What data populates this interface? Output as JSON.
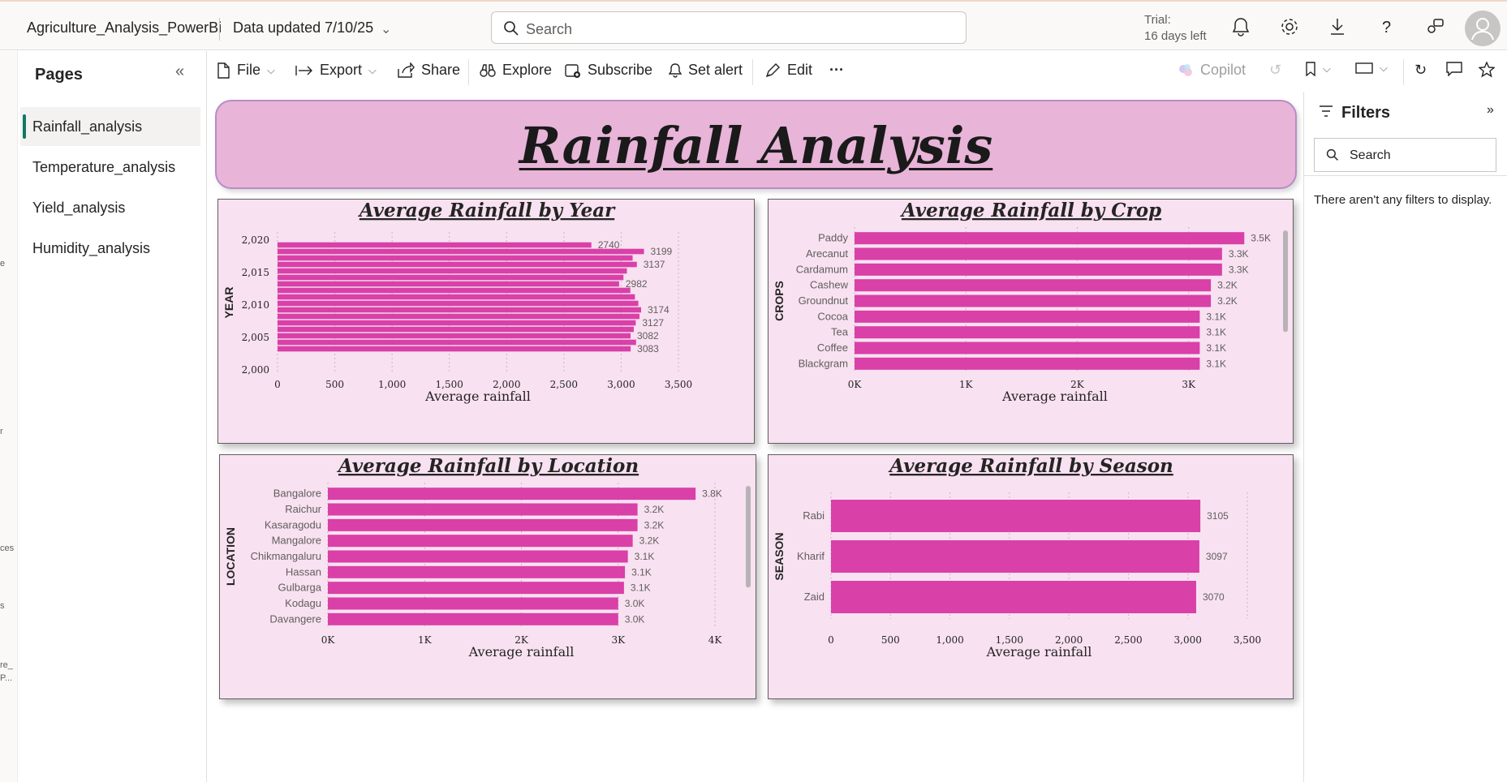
{
  "topbar": {
    "app_name": "Agriculture_Analysis_PowerBi",
    "updated": "Data updated 7/10/25",
    "search_placeholder": "Search",
    "trial_line1": "Trial:",
    "trial_line2": "16 days left"
  },
  "leftrail": {
    "fragments": [
      "e",
      "r",
      "ces",
      "s",
      "re_",
      "P..."
    ]
  },
  "pages": {
    "title": "Pages",
    "items": [
      {
        "label": "Rainfall_analysis",
        "active": true
      },
      {
        "label": "Temperature_analysis",
        "active": false
      },
      {
        "label": "Yield_analysis",
        "active": false
      },
      {
        "label": "Humidity_analysis",
        "active": false
      }
    ]
  },
  "commandbar": {
    "file": "File",
    "export": "Export",
    "share": "Share",
    "explore": "Explore",
    "subscribe": "Subscribe",
    "set_alert": "Set alert",
    "edit": "Edit",
    "more": "···",
    "copilot": "Copilot"
  },
  "filters": {
    "title": "Filters",
    "search_placeholder": "Search",
    "empty_message": "There aren't any filters to display."
  },
  "report": {
    "title": "Rainfall Analysis",
    "bar_color": "#d940a8",
    "panel_bg": "#f8e1f1",
    "banner_bg": "#e8b4d8"
  },
  "chart_data": [
    {
      "id": "year",
      "type": "bar",
      "orientation": "horizontal",
      "title": "Average Rainfall by Year",
      "xlabel": "Average rainfall",
      "ylabel": "YEAR",
      "xlim": [
        0,
        3500
      ],
      "xticks": [
        "0",
        "500",
        "1,000",
        "1,500",
        "2,000",
        "2,500",
        "3,000",
        "3,500"
      ],
      "yticks": [
        "2,020",
        "2,015",
        "2,010",
        "2,005",
        "2,000"
      ],
      "ylim": [
        2000,
        2020
      ],
      "categories": [
        2020,
        2019,
        2018,
        2017,
        2016,
        2015,
        2014,
        2013,
        2012,
        2011,
        2010,
        2009,
        2008,
        2007,
        2006,
        2005,
        2004
      ],
      "values": [
        2740,
        3199,
        3100,
        3137,
        3050,
        3020,
        2982,
        3080,
        3120,
        3150,
        3174,
        3160,
        3127,
        3110,
        3082,
        3130,
        3083
      ],
      "labels": [
        "2740",
        "3199",
        "",
        "3137",
        "",
        "",
        "2982",
        "",
        "",
        "",
        "3174",
        "",
        "3127",
        "",
        "3082",
        "",
        "3083"
      ]
    },
    {
      "id": "crop",
      "type": "bar",
      "orientation": "horizontal",
      "title": "Average Rainfall by Crop",
      "xlabel": "Average rainfall",
      "ylabel": "CROPS",
      "xlim": [
        0,
        3600
      ],
      "xticks": [
        "0K",
        "1K",
        "2K",
        "3K"
      ],
      "categories": [
        "Paddy",
        "Arecanut",
        "Cardamum",
        "Cashew",
        "Groundnut",
        "Cocoa",
        "Tea",
        "Coffee",
        "Blackgram"
      ],
      "values": [
        3500,
        3300,
        3300,
        3200,
        3200,
        3100,
        3100,
        3100,
        3100
      ],
      "labels": [
        "3.5K",
        "3.3K",
        "3.3K",
        "3.2K",
        "3.2K",
        "3.1K",
        "3.1K",
        "3.1K",
        "3.1K"
      ]
    },
    {
      "id": "location",
      "type": "bar",
      "orientation": "horizontal",
      "title": "Average Rainfall by Location",
      "xlabel": "Average rainfall",
      "ylabel": "LOCATION",
      "xlim": [
        0,
        4000
      ],
      "xticks": [
        "0K",
        "1K",
        "2K",
        "3K",
        "4K"
      ],
      "categories": [
        "Bangalore",
        "Raichur",
        "Kasaragodu",
        "Mangalore",
        "Chikmangaluru",
        "Hassan",
        "Gulbarga",
        "Kodagu",
        "Davangere"
      ],
      "values": [
        3800,
        3200,
        3200,
        3150,
        3100,
        3070,
        3060,
        3000,
        3000
      ],
      "labels": [
        "3.8K",
        "3.2K",
        "3.2K",
        "3.2K",
        "3.1K",
        "3.1K",
        "3.1K",
        "3.0K",
        "3.0K"
      ]
    },
    {
      "id": "season",
      "type": "bar",
      "orientation": "horizontal",
      "title": "Average Rainfall by Season",
      "xlabel": "Average rainfall",
      "ylabel": "SEASON",
      "xlim": [
        0,
        3500
      ],
      "xticks": [
        "0",
        "500",
        "1,000",
        "1,500",
        "2,000",
        "2,500",
        "3,000",
        "3,500"
      ],
      "categories": [
        "Rabi",
        "Kharif",
        "Zaid"
      ],
      "values": [
        3105,
        3097,
        3070
      ],
      "labels": [
        "3105",
        "3097",
        "3070"
      ]
    }
  ]
}
